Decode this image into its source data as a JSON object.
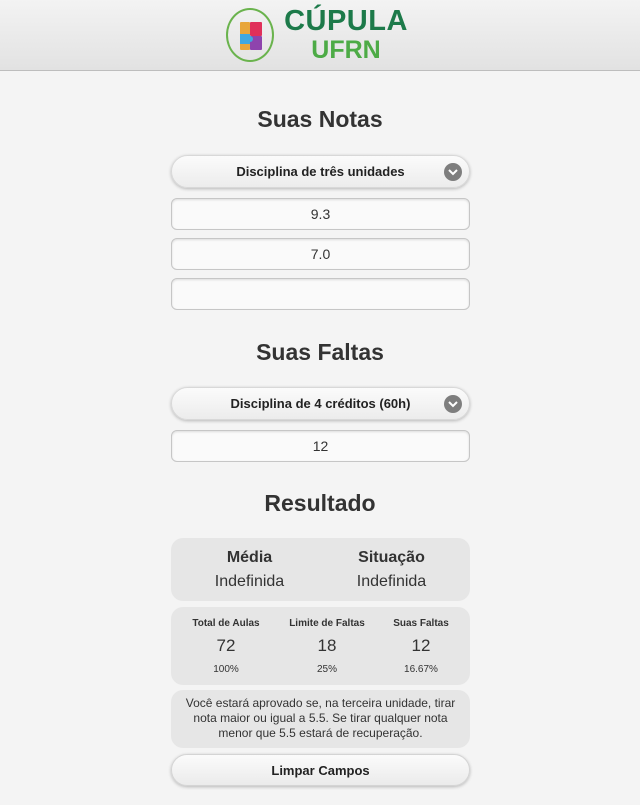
{
  "header": {
    "logo_title": "CÚPULA",
    "logo_subtitle": "UFRN"
  },
  "grades": {
    "title": "Suas Notas",
    "select_value": "Disciplina de três unidades",
    "inputs": [
      "9.3",
      "7.0",
      ""
    ]
  },
  "absences": {
    "title": "Suas Faltas",
    "select_value": "Disciplina de 4 créditos (60h)",
    "input": "12"
  },
  "result": {
    "title": "Resultado",
    "media_label": "Média",
    "media_value": "Indefinida",
    "situacao_label": "Situação",
    "situacao_value": "Indefinida",
    "stats": [
      {
        "label": "Total de Aulas",
        "value": "72",
        "pct": "100%"
      },
      {
        "label": "Limite de Faltas",
        "value": "18",
        "pct": "25%"
      },
      {
        "label": "Suas Faltas",
        "value": "12",
        "pct": "16.67%"
      }
    ],
    "message": "Você estará aprovado se, na terceira unidade, tirar nota maior ou igual a 5.5. Se tirar qualquer nota menor que 5.5 estará de recuperação."
  },
  "clear_button": "Limpar Campos",
  "colors": {
    "logo_dark_green": "#1d7a4a",
    "logo_light_green": "#4dab46"
  }
}
